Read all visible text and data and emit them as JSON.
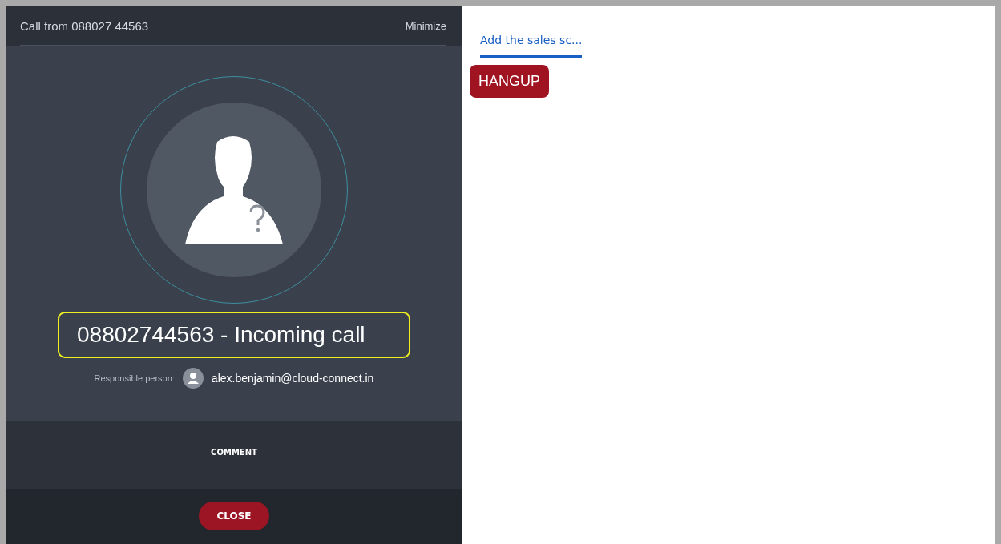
{
  "call_panel": {
    "title": "Call from 088027 44563",
    "minimize": "Minimize",
    "caller_status": "08802744563 - Incoming call",
    "responsible_label": "Responsible person:",
    "responsible_email": "alex.benjamin@cloud-connect.in",
    "tabs": [
      {
        "label": "COMMENT",
        "selected": true
      }
    ],
    "close_button": "CLOSE"
  },
  "script_panel": {
    "tabs": [
      {
        "label": "Add the sales sc...",
        "selected": true
      }
    ],
    "hangup_button": "HANGUP"
  }
}
